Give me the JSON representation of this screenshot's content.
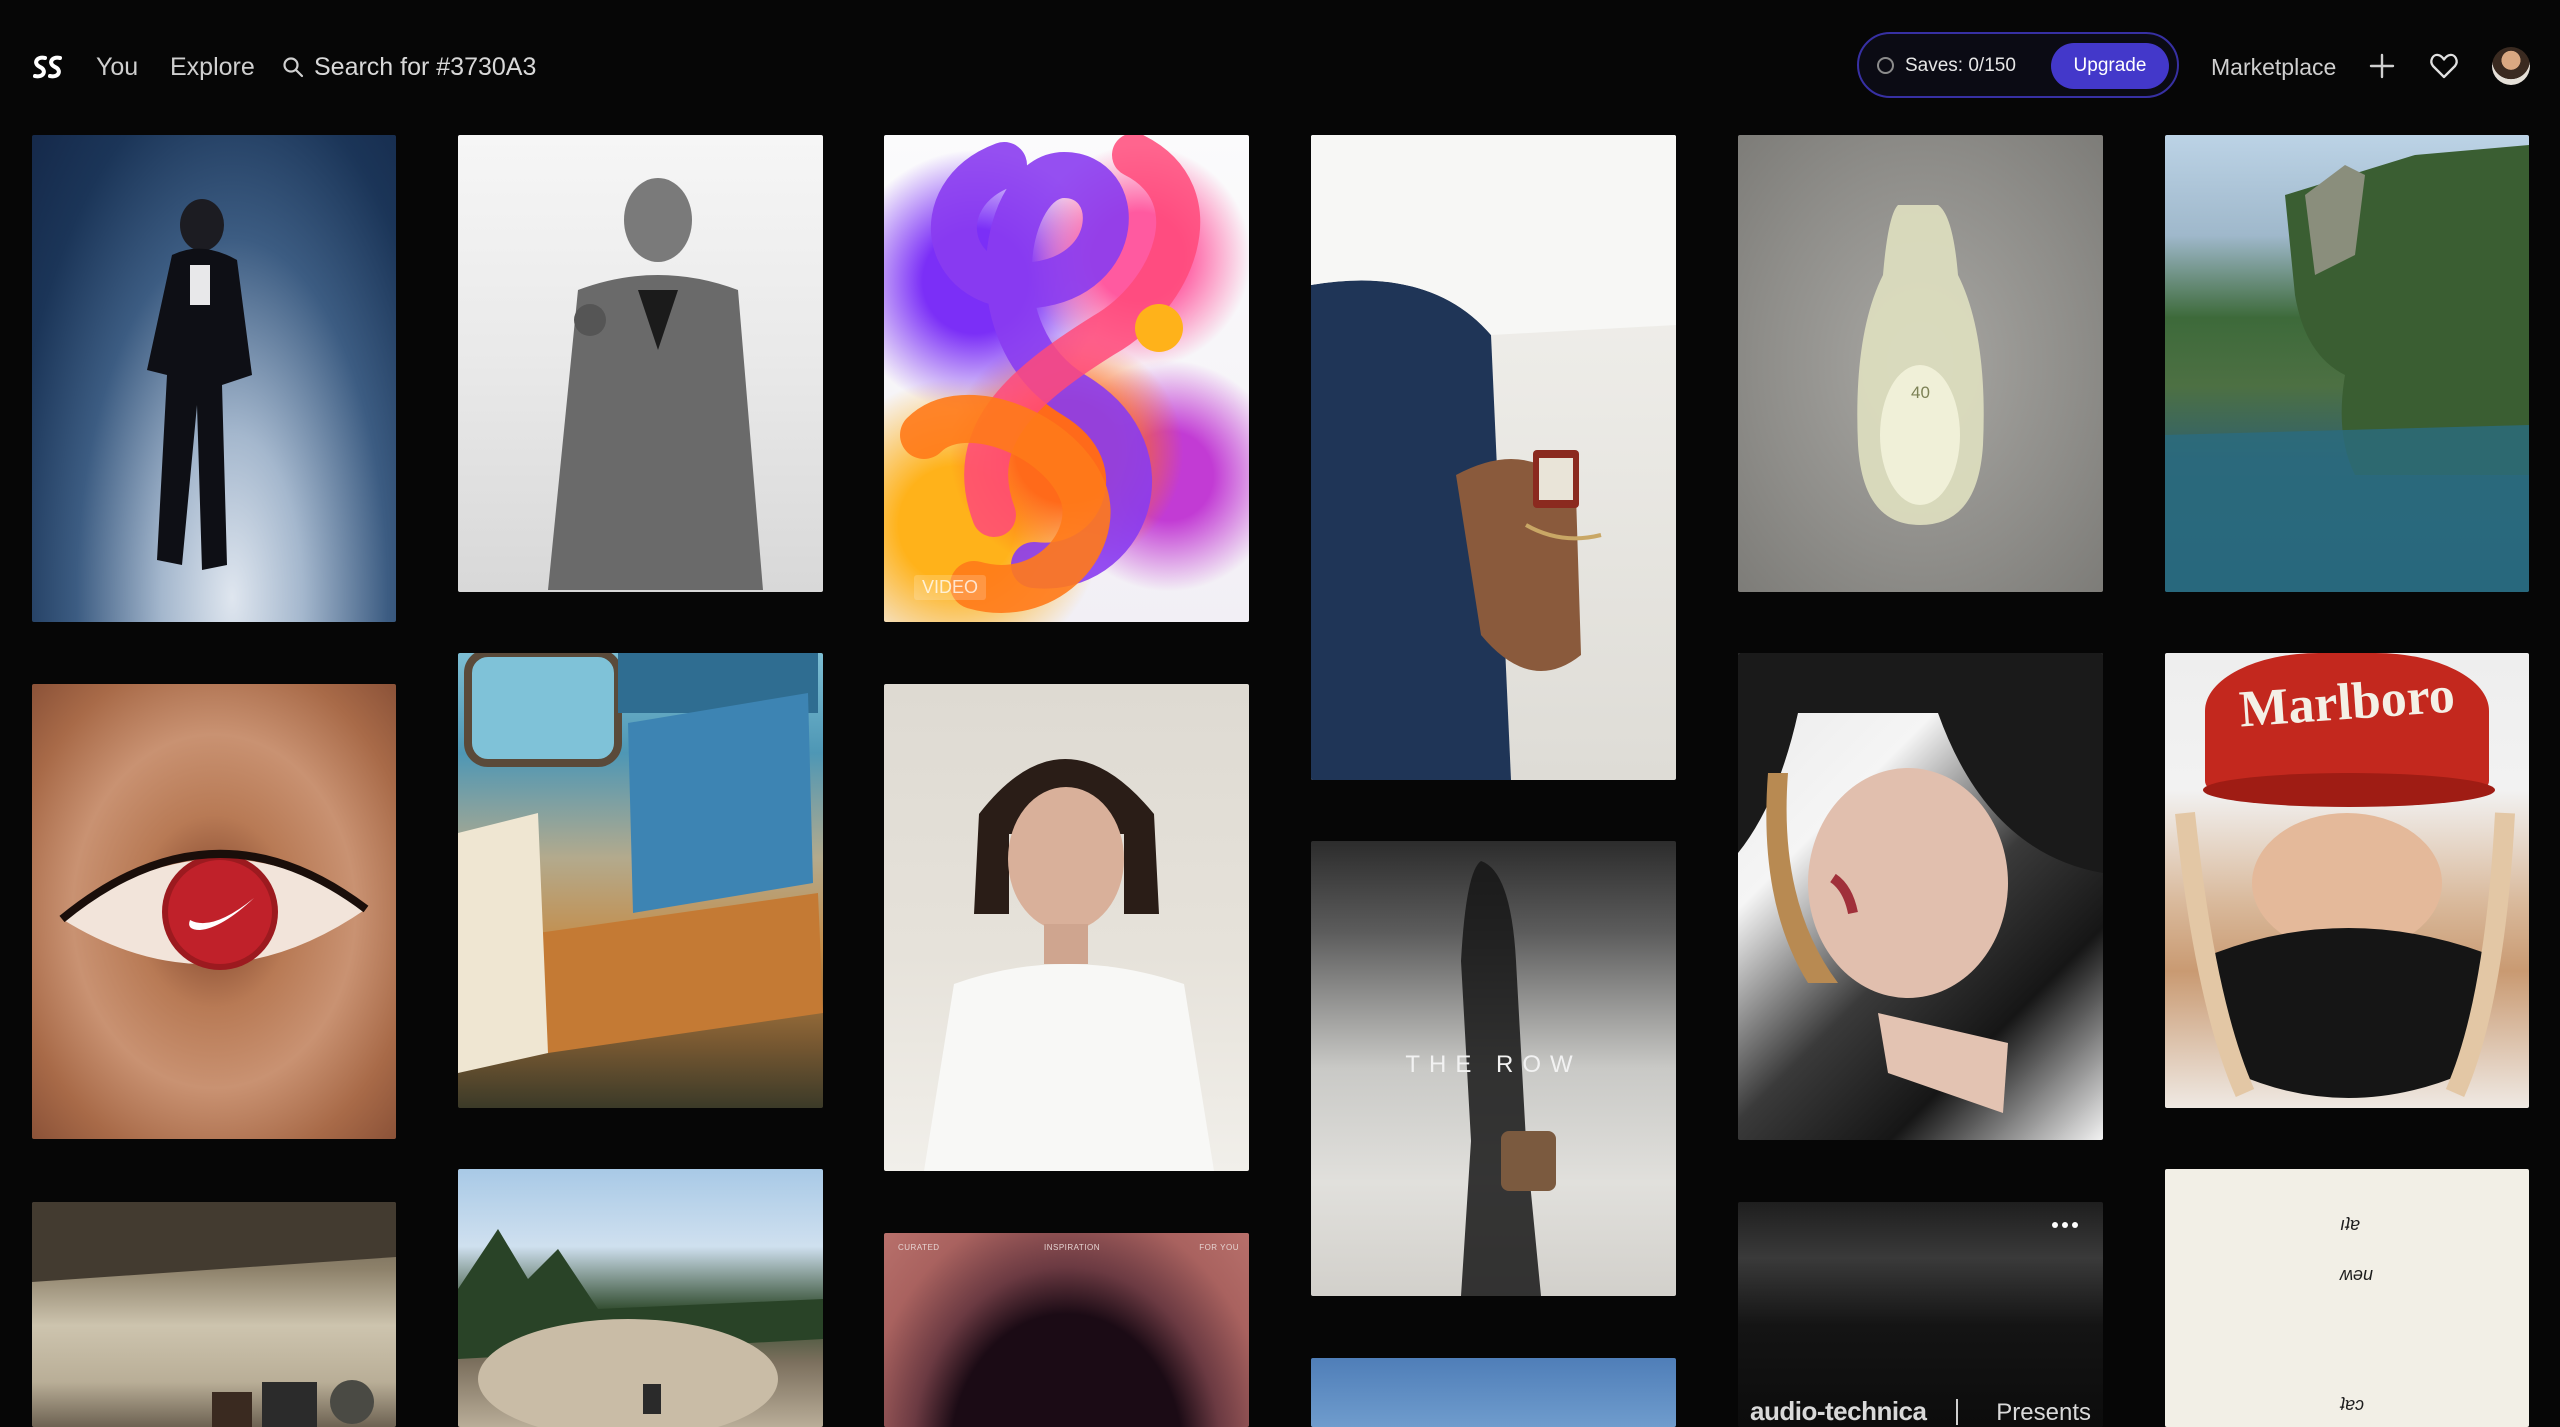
{
  "header": {
    "nav_you": "You",
    "nav_explore": "Explore",
    "search_placeholder": "Search for #3730A3",
    "saves_label": "Saves: 0/150",
    "upgrade_label": "Upgrade",
    "marketplace_label": "Marketplace"
  },
  "tiles": {
    "swirl": {
      "tag": "VIDEO"
    },
    "watch": {},
    "row": {
      "overlay_text": "THE ROW"
    },
    "shoe": {
      "number": "40"
    },
    "cap": {
      "logo_text": "Marlboro"
    },
    "curated": {
      "left": "CURATED",
      "center": "INSPIRATION",
      "right": "FOR YOU"
    },
    "audio": {
      "brand": "audio-technica",
      "presents": "Presents"
    },
    "paper": {
      "line1": "ıʇɐ",
      "line2": "ʍǝu",
      "line3": "ʇɐɔ"
    }
  },
  "colors": {
    "accent": "#3730a3",
    "upgrade": "#4338ca",
    "background": "#060606"
  },
  "icons": [
    "logo-icon",
    "search-icon",
    "circle-icon",
    "plus-icon",
    "heart-icon",
    "more-icon"
  ]
}
